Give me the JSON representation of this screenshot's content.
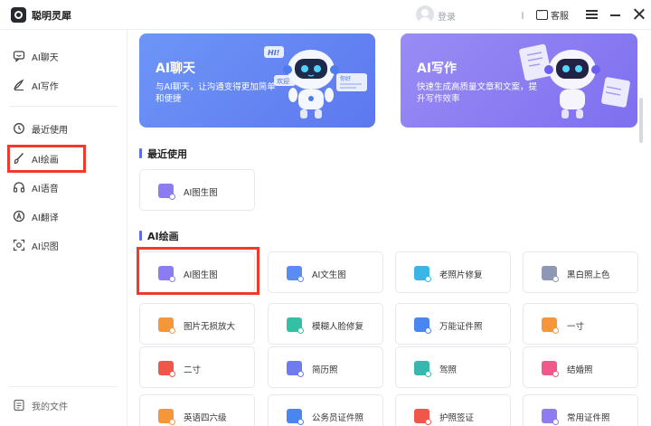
{
  "app": {
    "title": "聪明灵犀"
  },
  "header": {
    "login_label": "登录",
    "service_label": "客服"
  },
  "sidebar": {
    "items": [
      {
        "label": "AI聊天",
        "icon": "chat-icon"
      },
      {
        "label": "AI写作",
        "icon": "pen-icon"
      },
      {
        "label": "最近使用",
        "icon": "history-icon"
      },
      {
        "label": "AI绘画",
        "icon": "brush-icon"
      },
      {
        "label": "AI语音",
        "icon": "headset-icon"
      },
      {
        "label": "AI翻译",
        "icon": "translate-icon"
      },
      {
        "label": "AI识图",
        "icon": "scan-icon"
      }
    ],
    "footer_label": "我的文件"
  },
  "banners": [
    {
      "title": "AI聊天",
      "desc": "与AI聊天，让沟通变得更加简单和便捷",
      "bubbles": [
        "HI!",
        "欢迎",
        "你好"
      ]
    },
    {
      "title": "AI写作",
      "desc": "快速生成高质量文章和文案，提升写作效率"
    }
  ],
  "sections": {
    "recent": {
      "title": "最近使用",
      "cards": [
        {
          "label": "AI图生图"
        }
      ]
    },
    "drawing": {
      "title": "AI绘画",
      "cards": [
        {
          "label": "AI图生图"
        },
        {
          "label": "AI文生图"
        },
        {
          "label": "老照片修复"
        },
        {
          "label": "黑白照上色"
        },
        {
          "label": "图片无损放大"
        },
        {
          "label": "模糊人脸修复"
        },
        {
          "label": "万能证件照"
        },
        {
          "label": "一寸"
        },
        {
          "label": "二寸"
        },
        {
          "label": "简历照"
        },
        {
          "label": "驾照"
        },
        {
          "label": "结婚照"
        },
        {
          "label": "英语四六级"
        },
        {
          "label": "公务员证件照"
        },
        {
          "label": "护照签证"
        },
        {
          "label": "常用证件照"
        }
      ]
    }
  },
  "colors": {
    "accent": "#5b6cf2",
    "highlight": "#f03a2c",
    "banner_chat": "#6b8cf5",
    "banner_write": "#8c7cf0"
  }
}
